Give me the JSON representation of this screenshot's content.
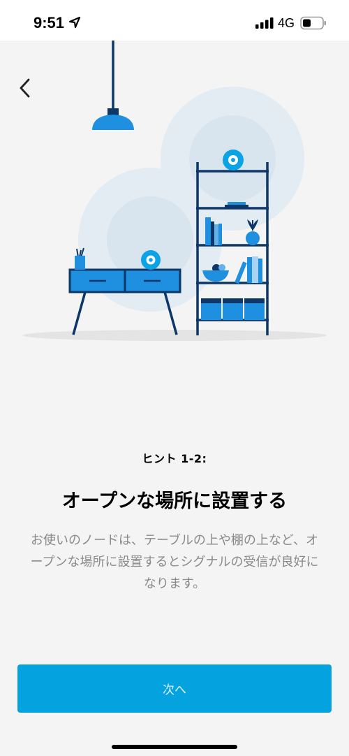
{
  "status_bar": {
    "time": "9:51",
    "network": "4G",
    "icons": [
      "location-arrow-icon",
      "cellular-signal-icon",
      "battery-icon"
    ]
  },
  "nav": {
    "back_icon": "chevron-left-icon"
  },
  "content": {
    "hint_label": "ヒント 1-2:",
    "headline": "オープンな場所に設置する",
    "body": "お使いのノードは、テーブルの上や棚の上など、オープンな場所に設置するとシグナルの受信が良好になります。"
  },
  "footer": {
    "next_label": "次へ"
  },
  "colors": {
    "accent": "#04a3e0",
    "navy": "#0d3768",
    "blue": "#1f8fe0",
    "background": "#f4f4f4"
  }
}
